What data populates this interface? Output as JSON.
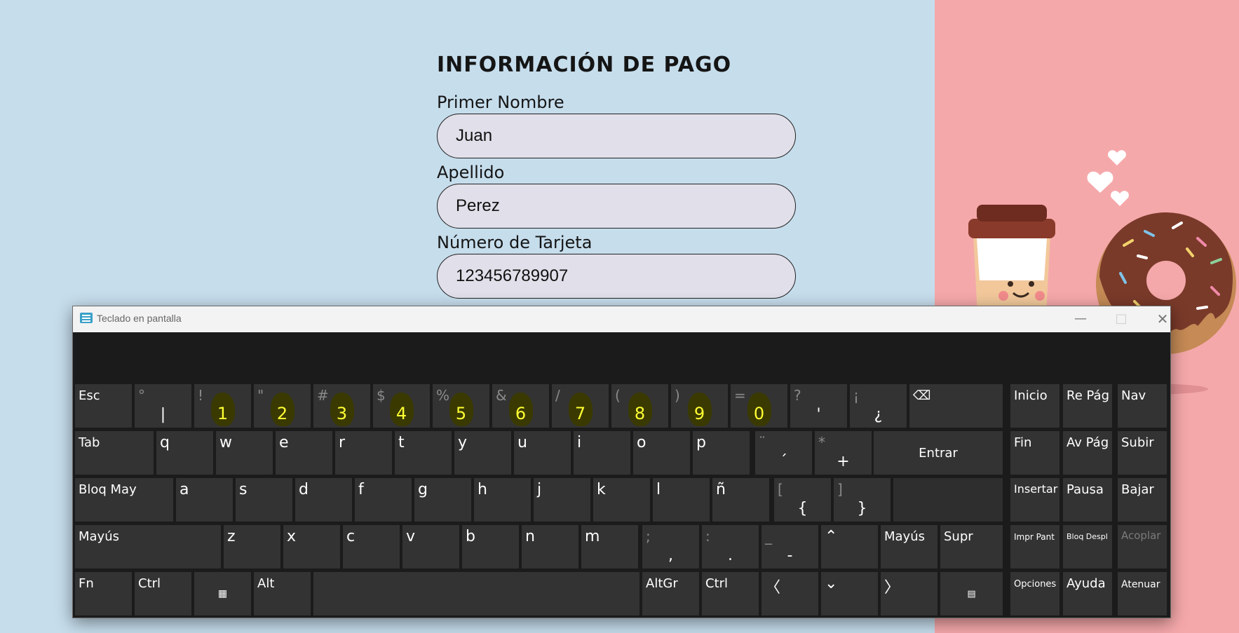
{
  "form": {
    "title": "INFORMACIÓN DE PAGO",
    "first_name_label": "Primer Nombre",
    "first_name_value": "Juan",
    "last_name_label": "Apellido",
    "last_name_value": "Perez",
    "card_label": "Número de Tarjeta",
    "card_value": "123456789907"
  },
  "osk": {
    "title": "Teclado en pantalla",
    "row1": {
      "esc": "Esc",
      "keys": [
        {
          "top": "°",
          "bot": "|"
        },
        {
          "top": "!",
          "num": "1"
        },
        {
          "top": "\"",
          "num": "2"
        },
        {
          "top": "#",
          "num": "3"
        },
        {
          "top": "$",
          "num": "4"
        },
        {
          "top": "%",
          "num": "5"
        },
        {
          "top": "&",
          "num": "6"
        },
        {
          "top": "/",
          "num": "7"
        },
        {
          "top": "(",
          "num": "8"
        },
        {
          "top": ")",
          "num": "9"
        },
        {
          "top": "=",
          "num": "0"
        },
        {
          "top": "?",
          "bot": "'"
        },
        {
          "top": "¡",
          "bot": "¿"
        }
      ]
    },
    "row2": {
      "tab": "Tab",
      "letters": [
        "q",
        "w",
        "e",
        "r",
        "t",
        "y",
        "u",
        "i",
        "o",
        "p"
      ],
      "acute": {
        "top": "¨",
        "bot": "´"
      },
      "plus": {
        "top": "*",
        "bot": "+"
      },
      "enter": "Entrar"
    },
    "row3": {
      "caps": "Bloq May",
      "letters": [
        "a",
        "s",
        "d",
        "f",
        "g",
        "h",
        "j",
        "k",
        "l",
        "ñ"
      ],
      "brace_open": {
        "top": "[",
        "bot": "{"
      },
      "brace_close": {
        "top": "]",
        "bot": "}"
      }
    },
    "row4": {
      "shift_left": "Mayús",
      "letters": [
        "z",
        "x",
        "c",
        "v",
        "b",
        "n",
        "m"
      ],
      "comma": {
        "top": ";",
        "bot": ","
      },
      "period": {
        "top": ":",
        "bot": "."
      },
      "dash": {
        "top": "_",
        "bot": "-"
      },
      "shift_right": "Mayús",
      "delete": "Supr"
    },
    "row5": {
      "fn": "Fn",
      "ctrl_left": "Ctrl",
      "alt": "Alt",
      "altgr": "AltGr",
      "ctrl_right": "Ctrl"
    },
    "nav": {
      "home": "Inicio",
      "pgup": "Re Pág",
      "nav": "Nav",
      "end": "Fin",
      "pgdn": "Av Pág",
      "up": "Subir",
      "insert": "Insertar",
      "pause": "Pausa",
      "down": "Bajar",
      "prtsc": "Impr Pant",
      "scrlk": "Bloq Despl",
      "dock": "Acoplar",
      "options": "Opciones",
      "help": "Ayuda",
      "fade": "Atenuar"
    }
  }
}
